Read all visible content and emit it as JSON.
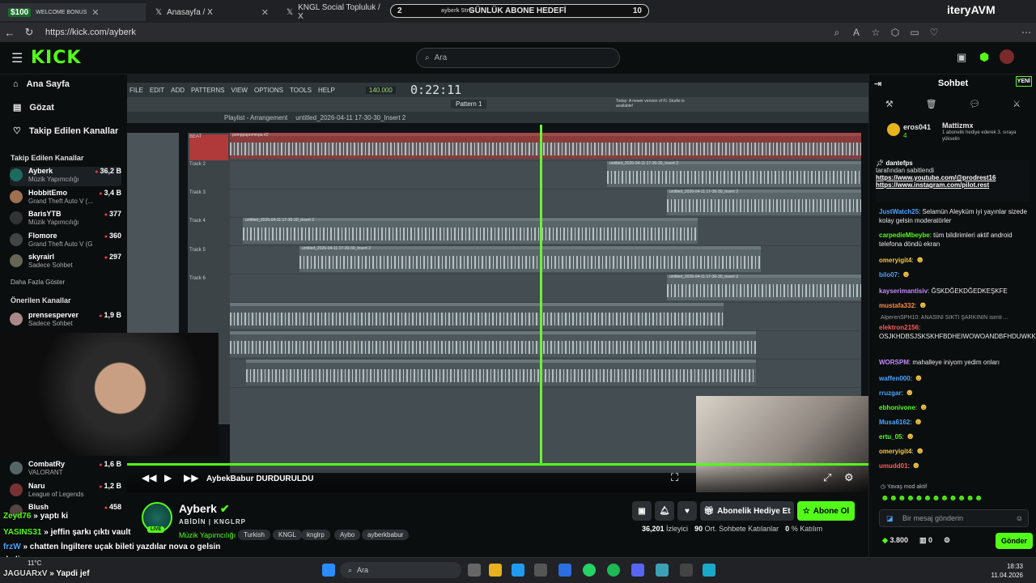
{
  "browser": {
    "tabs": [
      {
        "label": "WELCOME BONUS",
        "badge": "$100"
      },
      {
        "label": "Anasayfa / X"
      },
      {
        "label": "KNGL Social Topluluk / X"
      }
    ],
    "goal": {
      "left": "2",
      "title": "GÜNLÜK ABONE HEDEFİ",
      "right": "10",
      "sub": "ayberk Stre"
    },
    "url": "https://kick.com/ayberk",
    "brand": "iteryAVM"
  },
  "kick": {
    "search_placeholder": "Ara",
    "nav": [
      {
        "label": "Ana Sayfa"
      },
      {
        "label": "Gözat"
      },
      {
        "label": "Takip Edilen Kanallar"
      }
    ],
    "followed_header": "Takip Edilen Kanallar",
    "followed": [
      {
        "name": "Ayberk",
        "game": "Müzik Yapımcılığı",
        "viewers": "36,2 B"
      },
      {
        "name": "HobbitEmo",
        "game": "Grand Theft Auto V (...",
        "viewers": "3,4 B"
      },
      {
        "name": "BarisYTB",
        "game": "Müzik Yapımcılığı",
        "viewers": "377"
      },
      {
        "name": "Flomore",
        "game": "Grand Theft Auto V (G...",
        "viewers": "360"
      },
      {
        "name": "skyrairl",
        "game": "Sadece Sohbet",
        "viewers": "297"
      }
    ],
    "show_more": "Daha Fazla Göster",
    "recommended_header": "Önerilen Kanallar",
    "recommended": [
      {
        "name": "prensesperver",
        "game": "Sadece Sohbet",
        "viewers": "1,9 B"
      },
      {
        "name": "CombatRy",
        "game": "VALORANT",
        "viewers": "1,6 B"
      },
      {
        "name": "Naru",
        "game": "League of Legends",
        "viewers": "1,2 B"
      },
      {
        "name": "Blush",
        "game": "",
        "viewers": "458"
      }
    ]
  },
  "daw": {
    "menu": [
      "FILE",
      "EDIT",
      "ADD",
      "PATTERNS",
      "VIEW",
      "OPTIONS",
      "TOOLS",
      "HELP"
    ],
    "time": "0:22:11",
    "bpm": "140.000",
    "pattern": "Pattern 1",
    "playlist_title": "Playlist - Arrangement",
    "playlist_file": "untitled_2026-04-11 17-30-30_Insert 2",
    "track_labels": [
      "BEAT",
      "Track 2",
      "Track 3",
      "Track 4",
      "Track 5",
      "Track 6"
    ],
    "clip_label": "untitled_2026-04-11 17-30-30_Insert 2",
    "beat_clip": "pomppapommpa #2",
    "news": "Today: A newer version of FL Studio is available!"
  },
  "player": {
    "overlay_name": "AybekBabur",
    "overlay_status": "DURDURULDU"
  },
  "stream": {
    "name": "Ayberk",
    "title": "ABİDİN | KNGLRP",
    "category": "Müzik Yapımcılığı",
    "tags": [
      "Turkish",
      "KNGL",
      "knglrp",
      "Aybo",
      "ayberkbabur"
    ],
    "live": "LIVE",
    "gift_btn": "Abonelik Hediye Et",
    "sub_btn": "Abone Ol",
    "viewers": "36,201",
    "viewers_label": "İzleyici",
    "chatters": "90",
    "chatters_label": "Ort. Sohbete Katılanlar",
    "join_pct": "0",
    "join_label": "% Katılım"
  },
  "overlay_chat": [
    {
      "user": "Zeyd76",
      "text": "yaptı ki"
    },
    {
      "user": "YASINS31",
      "text": "jeffin şarkı çıktı vault"
    },
    {
      "user": "frzW",
      "text": "chatten İngiltere uçak bileti yazdılar nova o gelsin"
    },
    {
      "user": "",
      "text": "dedi"
    },
    {
      "user": "JAGUARxV",
      "text": "Yapdi jef"
    }
  ],
  "chat": {
    "title": "Sohbet",
    "new_label": "YENİ",
    "top_gifter": {
      "name": "eros041",
      "count": "4"
    },
    "gift_user": "Mattizmx",
    "gift_text": "1 abonelik hediye ederek 3. sıraya yükselin",
    "pinned_user": "dantefps",
    "pinned_text": "tarafından sabitlendi",
    "pinned_links": [
      "https://www.youtube.com/@prodrest16",
      "https://www.instagram.com/pilot.rest"
    ],
    "messages": [
      {
        "user": "JustWatch25",
        "color": "#4aa3ff",
        "text": "Selamün Aleyküm iyi yayınlar sizede kolay gelsin moderatörler"
      },
      {
        "user": "carpedieMbeybe",
        "color": "#53fc18",
        "text": "tüm bildirimleri aktif android telefona döndü ekran"
      },
      {
        "user": "omeryigit4",
        "color": "#f5c542",
        "text": ""
      },
      {
        "user": "bilo07",
        "color": "#4aa3ff",
        "text": ""
      },
      {
        "user": "kayserimantisiv",
        "color": "#c28bff",
        "text": "ĞSKDĞEKDĞEDKEŞKFE"
      },
      {
        "user": "mustafa332",
        "color": "#ff8c42",
        "text": ""
      },
      {
        "user": "elektron2156",
        "color": "#ff5a5a",
        "text": "OSJKHDBSJSKSKHFBDHEIWOWOANDBFHDUWKKSDHHD"
      },
      {
        "user": "WORSPM",
        "color": "#c28bff",
        "text": "mahalleye iniyom yedim onları"
      },
      {
        "user": "waffen000",
        "color": "#4aa3ff",
        "text": ""
      },
      {
        "user": "rruzgar",
        "color": "#4aa3ff",
        "text": ""
      },
      {
        "user": "ebhonivone",
        "color": "#53fc18",
        "text": ""
      },
      {
        "user": "Musa6162",
        "color": "#4aa3ff",
        "text": ""
      },
      {
        "user": "ertu_05",
        "color": "#53fc18",
        "text": ""
      },
      {
        "user": "omeryigit4",
        "color": "#f5c542",
        "text": ""
      },
      {
        "user": "umudd01",
        "color": "#ff5a5a",
        "text": ""
      }
    ],
    "reply_hint": "AlperenSPH10: ANASINI SİKTİ ŞARKININ isimli ...",
    "slow_mode": "Yavaş mod aktif",
    "input_placeholder": "Bir mesaj gönderin",
    "points": "3.800",
    "zero": "0",
    "send": "Gönder"
  },
  "taskbar": {
    "search": "Ara",
    "temp": "11°C",
    "time": "18:33",
    "date": "11.04.2026"
  }
}
